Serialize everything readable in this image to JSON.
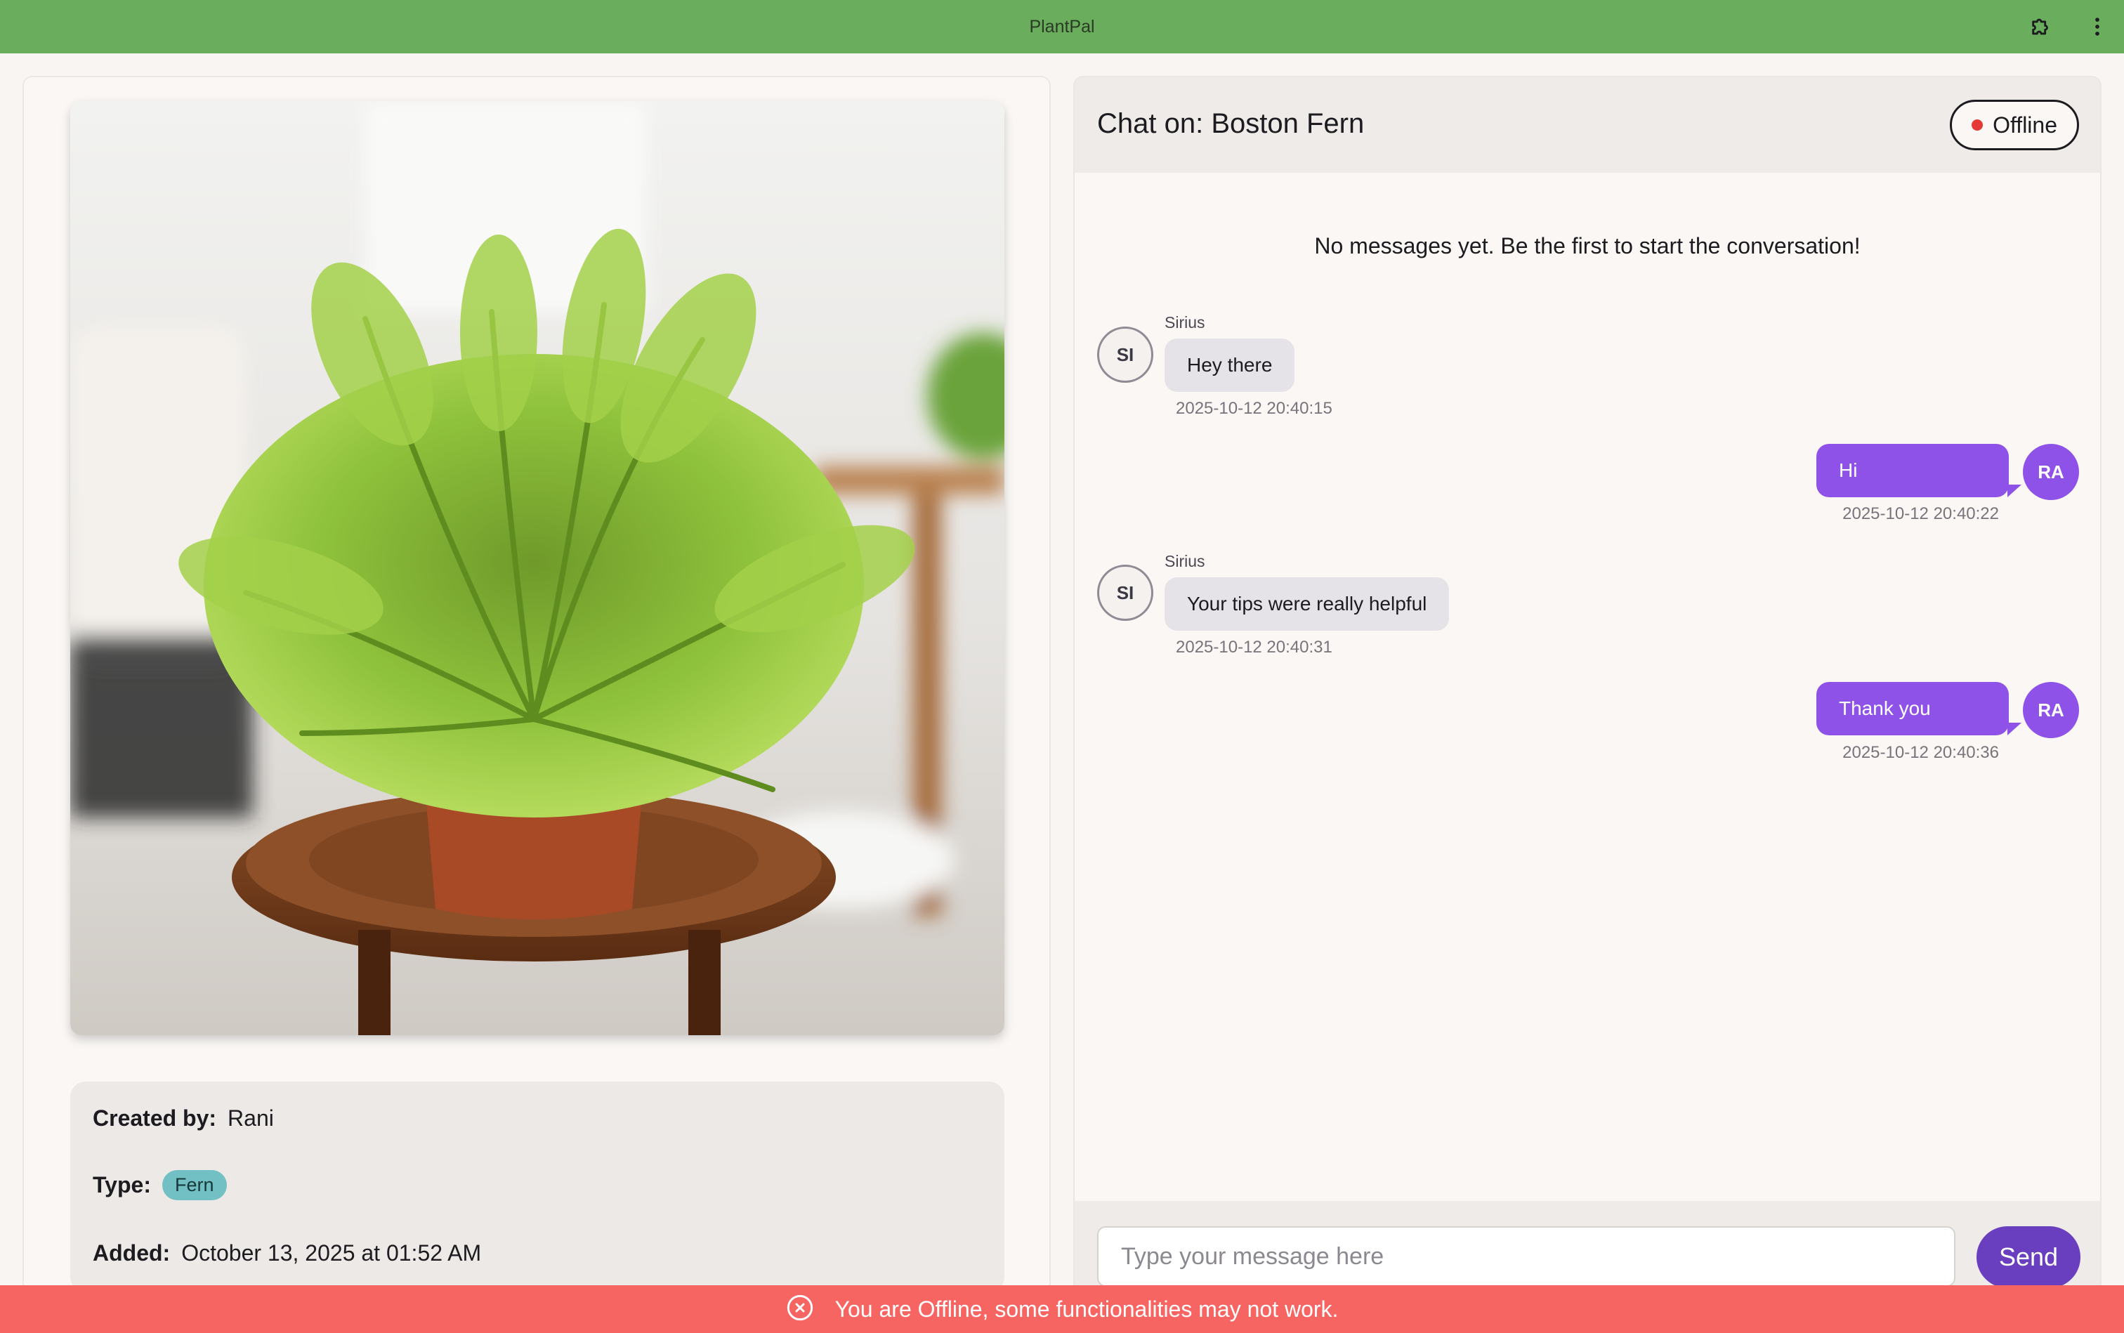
{
  "app": {
    "title": "PlantPal"
  },
  "colors": {
    "titlebar": "#69ad5d",
    "accent_purple": "#8f52e8",
    "send_button": "#6a3fbf",
    "banner": "#f76563",
    "chip": "#73c0c4",
    "offline_dot": "#e53935"
  },
  "icons": {
    "extension": "puzzle-icon",
    "menu": "kebab-menu-icon",
    "banner": "close-circle-icon"
  },
  "plant": {
    "image_alt": "Boston Fern",
    "created_by_label": "Created by:",
    "created_by": "Rani",
    "type_label": "Type:",
    "type": "Fern",
    "added_label": "Added:",
    "added": "October 13, 2025 at 01:52 AM"
  },
  "chat": {
    "title": "Chat on: Boston Fern",
    "status": "Offline",
    "empty_note": "No messages yet. Be the first to start the conversation!",
    "messages": [
      {
        "sender": "Sirius",
        "initials": "SI",
        "text": "Hey there",
        "time": "2025-10-12 20:40:15",
        "mine": false
      },
      {
        "sender": "",
        "initials": "RA",
        "text": "Hi",
        "time": "2025-10-12 20:40:22",
        "mine": true
      },
      {
        "sender": "Sirius",
        "initials": "SI",
        "text": "Your tips were really helpful",
        "time": "2025-10-12 20:40:31",
        "mine": false
      },
      {
        "sender": "",
        "initials": "RA",
        "text": "Thank you",
        "time": "2025-10-12 20:40:36",
        "mine": true
      }
    ],
    "input_placeholder": "Type your message here",
    "input_value": "",
    "send_label": "Send"
  },
  "banner": {
    "text": "You are Offline, some functionalities may not work."
  }
}
